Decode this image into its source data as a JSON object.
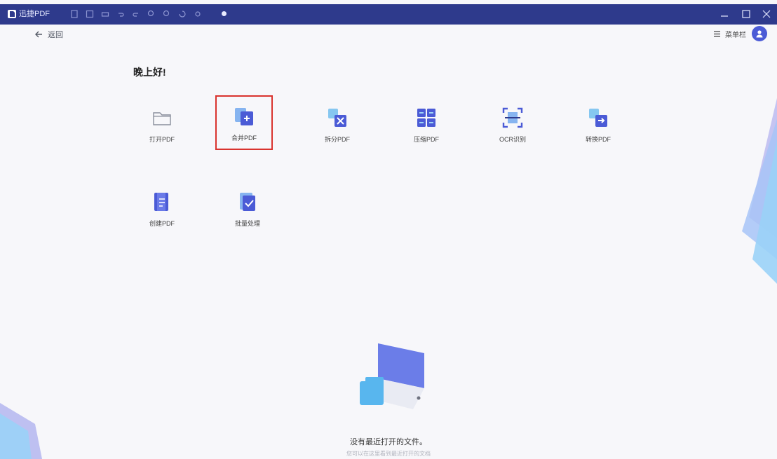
{
  "app": {
    "title": "迅捷PDF",
    "titlebar_color": "#2e3a8c",
    "accent": "#4b5bd6"
  },
  "nav": {
    "back_label": "返回",
    "back_icon": "arrow-left-icon",
    "menu_label": "菜单栏",
    "menu_icon": "menu-icon",
    "avatar_icon": "user-avatar-icon"
  },
  "section": {
    "title": "晚上好!"
  },
  "tools": [
    {
      "label": "打开PDF",
      "icon": "folder-open-icon",
      "selected": false
    },
    {
      "label": "合并PDF",
      "icon": "merge-pdf-icon",
      "selected": true
    },
    {
      "label": "拆分PDF",
      "icon": "split-pdf-icon",
      "selected": false
    },
    {
      "label": "压缩PDF",
      "icon": "compress-pdf-icon",
      "selected": false
    },
    {
      "label": "OCR识别",
      "icon": "ocr-scan-icon",
      "selected": false
    },
    {
      "label": "转换PDF",
      "icon": "convert-pdf-icon",
      "selected": false
    },
    {
      "label": "创建PDF",
      "icon": "create-pdf-icon",
      "selected": false
    },
    {
      "label": "批量处理",
      "icon": "batch-process-icon",
      "selected": false
    }
  ],
  "empty_state": {
    "text": "没有最近打开的文件。",
    "hint": "您可以在这里看到最近打开的文档"
  },
  "colors": {
    "selection_border": "#d9332e",
    "background": "#f7f7fa"
  }
}
